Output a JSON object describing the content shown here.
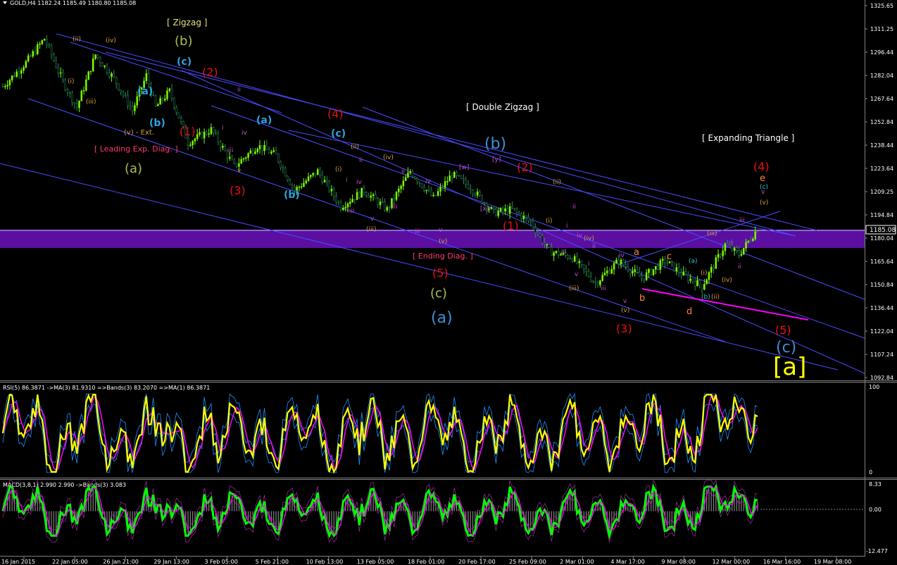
{
  "header": {
    "symbol_line": "GOLD,H4  1182.24 1185.49 1180.80 1185.08"
  },
  "colors": {
    "background": "#000000",
    "bull": "#7CFC00",
    "bear": "#2E8B57",
    "channel": "#4a4aff",
    "band": "#5A0FA0",
    "rsi": "#FFFF00",
    "ma": "#FF00FF",
    "bands": "#1E90FF",
    "macd": "#00FF00",
    "hist": "#808080",
    "pink_line": "#FF00FF"
  },
  "main": {
    "y_ticks": [
      "1325.65",
      "1311.25",
      "1296.44",
      "1282.04",
      "1267.64",
      "1252.84",
      "1238.44",
      "1223.64",
      "1209.25",
      "1194.84",
      "1180.04",
      "1165.64",
      "1150.84",
      "1136.44",
      "1122.04",
      "1107.24",
      "1092.84"
    ],
    "price_tag": "1185.08",
    "annotations": {
      "zigzag": "[ Zigzag ]",
      "double_zigzag": "[ Double Zigzag ]",
      "expanding_triangle": "[ Expanding Triangle ]",
      "leading_diag": "[ Leading Exp. Diag. ]",
      "ending_diag": "[ Ending Diag. ]",
      "ext": "(v) - Ext."
    }
  },
  "rsi": {
    "label": "RSI(5) 86.3871  ->MA(3) 81.9310  =>Bands(3) 83.2070  =>MA(1) 86.3871",
    "y_ticks": [
      "100",
      "0"
    ]
  },
  "macd": {
    "label": "MACD(3,8,1) 2.990 2.990  ->Bands(3) 3.083",
    "y_ticks": [
      "8.33",
      "0.00",
      "-12.477"
    ]
  },
  "x_axis": {
    "labels": [
      "16 Jan 2015",
      "22 Jan 05:00",
      "26 Jan 21:00",
      "29 Jan 13:00",
      "3 Feb 05:00",
      "5 Feb 21:00",
      "10 Feb 13:00",
      "13 Feb 05:00",
      "18 Feb 01:00",
      "20 Feb 17:00",
      "25 Feb 09:00",
      "2 Mar 01:00",
      "4 Mar 17:00",
      "9 Mar 08:00",
      "12 Mar 00:00",
      "16 Mar 16:00",
      "19 Mar 08:00"
    ]
  },
  "chart_data": {
    "type": "candlestick",
    "price_ylim": [
      1092.84,
      1325.65
    ],
    "rsi_ylim": [
      0,
      100
    ],
    "macd_ylim": [
      -12.477,
      8.33
    ],
    "trend_path": [
      [
        0,
        1275
      ],
      [
        10,
        1290
      ],
      [
        18,
        1305
      ],
      [
        26,
        1278
      ],
      [
        32,
        1262
      ],
      [
        40,
        1295
      ],
      [
        48,
        1280
      ],
      [
        56,
        1260
      ],
      [
        62,
        1282
      ],
      [
        66,
        1262
      ],
      [
        72,
        1272
      ],
      [
        80,
        1240
      ],
      [
        90,
        1248
      ],
      [
        100,
        1225
      ],
      [
        110,
        1238
      ],
      [
        118,
        1232
      ],
      [
        126,
        1210
      ],
      [
        136,
        1222
      ],
      [
        146,
        1200
      ],
      [
        156,
        1210
      ],
      [
        166,
        1198
      ],
      [
        176,
        1222
      ],
      [
        186,
        1205
      ],
      [
        194,
        1220
      ],
      [
        202,
        1212
      ],
      [
        212,
        1196
      ],
      [
        220,
        1198
      ],
      [
        228,
        1190
      ],
      [
        236,
        1172
      ],
      [
        246,
        1168
      ],
      [
        256,
        1152
      ],
      [
        266,
        1166
      ],
      [
        276,
        1155
      ],
      [
        286,
        1166
      ],
      [
        294,
        1157
      ],
      [
        302,
        1150
      ],
      [
        312,
        1176
      ],
      [
        318,
        1170
      ],
      [
        326,
        1186
      ]
    ]
  }
}
